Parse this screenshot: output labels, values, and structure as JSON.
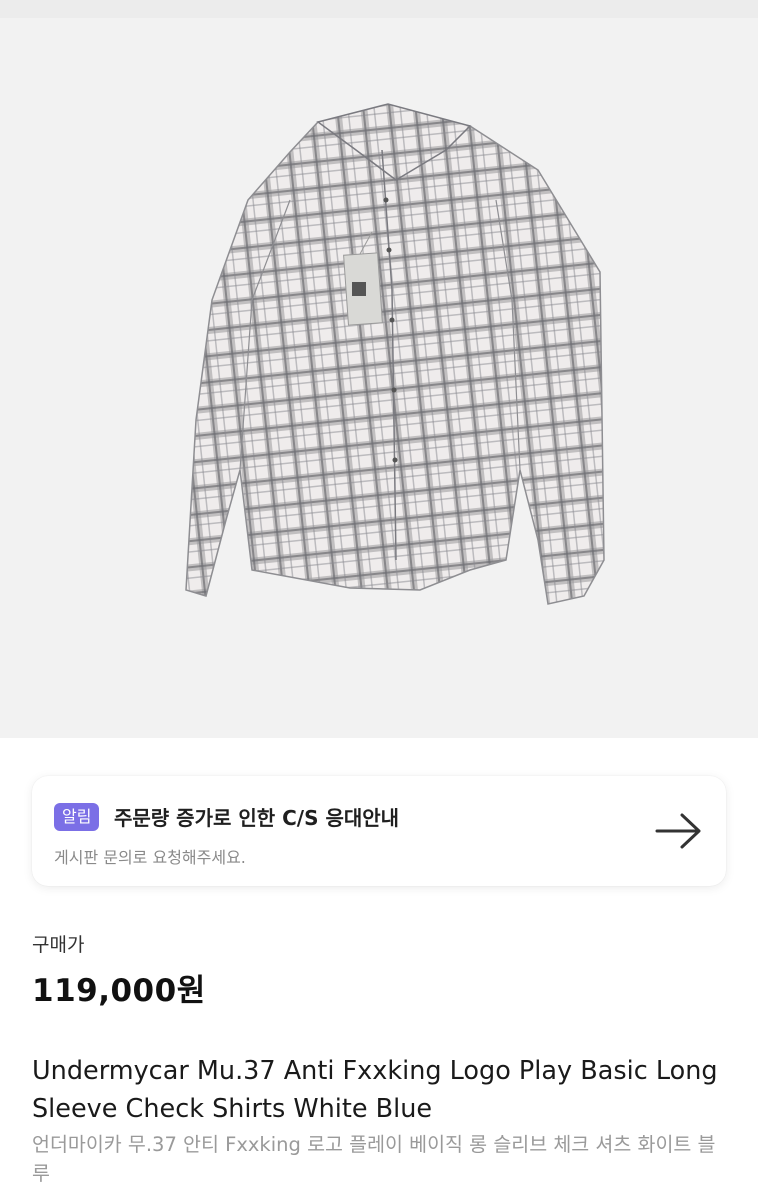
{
  "product_image": {
    "icon": "check-shirt-photo"
  },
  "notice": {
    "badge": "알림",
    "title": "주문량 증가로 인한 C/S 응대안내",
    "description": "게시판 문의로 요청해주세요.",
    "arrow_icon": "arrow-right-icon",
    "badge_color": "#7b6fe6"
  },
  "price": {
    "label": "구매가",
    "value": "119,000원"
  },
  "product": {
    "name_en": "Undermycar Mu.37 Anti Fxxking Logo Play Basic Long Sleeve Check Shirts White Blue",
    "name_ko": "언더마이카 무.37 안티 Fxxking 로고 플레이 베이직 롱 슬리브 체크 셔츠 화이트 블루"
  }
}
